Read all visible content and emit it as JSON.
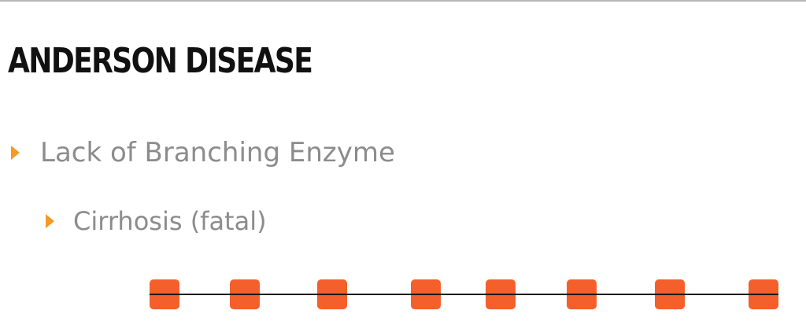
{
  "title": "ANDERSON DISEASE",
  "bullets": [
    {
      "text": "Lack of Branching Enzyme"
    },
    {
      "text": "Cirrhosis (fatal)"
    }
  ],
  "colors": {
    "accent": "#f39a25",
    "glucose_unit": "#f45f2c",
    "text_primary": "#111111",
    "text_secondary": "#8c8c8c"
  },
  "icons": {
    "bullet": "triangle-right"
  },
  "glucose_chain": {
    "unit_count": 8
  }
}
